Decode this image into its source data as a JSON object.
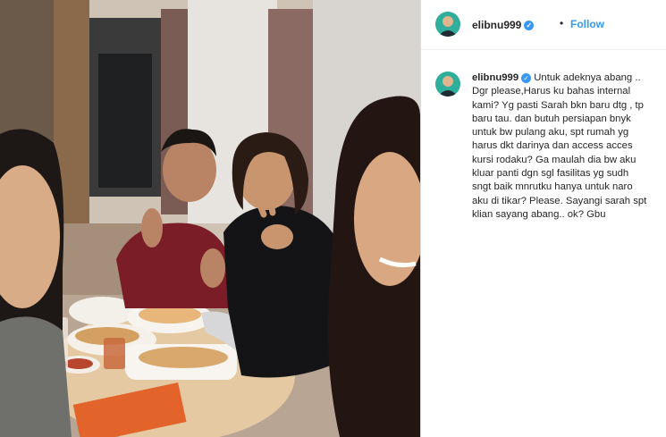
{
  "post": {
    "username": "elibnu999",
    "verified_mark": "✓",
    "dot": "•",
    "follow_label": "Follow",
    "caption": "Untuk adeknya abang ..\nDgr please,Harus ku bahas internal\nkami? Yg pasti Sarah bkn baru dtg , tp\nbaru tau. dan butuh persiapan bnyk\nuntuk bw pulang aku, spt rumah yg\nharus dkt darinya dan access acces\nkursi rodaku? Ga maulah dia bw aku\nkluar panti dgn sgl fasilitas yg sudh\nsngt baik mnrutku hanya untuk naro\naku di tikar? Please. Sayangi sarah spt\nklian sayang abang.. ok? Gbu"
  },
  "colors": {
    "link": "#3897f0",
    "verified": "#3897f0",
    "text": "#262626",
    "border": "#dbdbdb"
  },
  "icons": [
    "verified-badge-icon",
    "avatar"
  ]
}
